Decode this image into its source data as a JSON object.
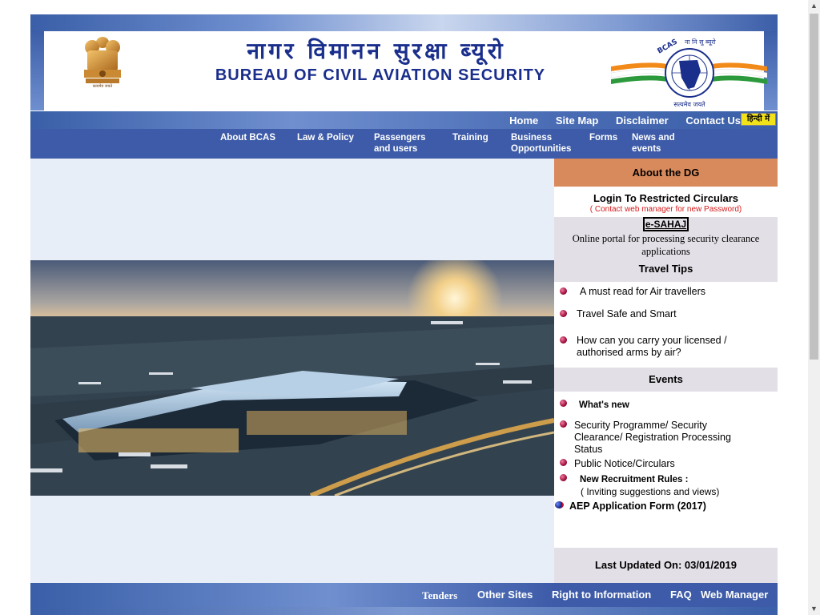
{
  "header": {
    "hindi_title": "नागर विमानन सुरक्षा ब्यूरो",
    "english_title": "BUREAU OF CIVIL AVIATION SECURITY",
    "logo_top_text": "BCAS",
    "logo_hindi_top": "ना नि सु ब्यूरो",
    "logo_motto": "सत्यमेव जयते"
  },
  "util_nav": {
    "links": [
      "Home",
      "Site Map",
      "Disclaimer",
      "Contact Us"
    ],
    "hindi_button": "हिन्दी में"
  },
  "main_nav": [
    "About BCAS",
    "Law & Policy",
    "Passengers and users",
    "Training",
    "Business Opportunities",
    "Forms",
    "News and events"
  ],
  "main_nav_lines": [
    [
      "About BCAS",
      ""
    ],
    [
      "Law & Policy",
      ""
    ],
    [
      "Passengers",
      "and users"
    ],
    [
      "Training",
      ""
    ],
    [
      "Business",
      "Opportunities"
    ],
    [
      "Forms",
      ""
    ],
    [
      "News and",
      "events"
    ]
  ],
  "right_col": {
    "about_dg": "About the DG",
    "login_title": "Login To Restricted Circulars",
    "login_note": "(  Contact web manager for new Password)",
    "esahaj_label": "e-SAHAJ",
    "esahaj_desc": "Online portal for processing security clearance applications",
    "travel_tips_head": "Travel Tips",
    "travel_tips": [
      "A must read for Air travellers",
      "Travel Safe and Smart",
      "How can you carry your   licensed / authorised arms by air?"
    ],
    "events_head": "Events",
    "events": {
      "whats_new": "What's new",
      "security_programme": "Security Programme/ Security Clearance/ Registration Processing Status",
      "public_notice": "Public Notice/Circulars",
      "recruitment_title": "New Recruitment Rules :",
      "recruitment_note": "( Inviting suggestions and views)",
      "aep": "AEP Application  Form (2017)"
    },
    "last_updated": "Last Updated On: 03/01/2019"
  },
  "footer_nav": [
    "Tenders",
    "Other Sites",
    "Right to Information",
    "FAQ",
    "Web Manager"
  ],
  "colors": {
    "nav_blue": "#3d5ba8",
    "title_blue": "#1a2e8c",
    "dg_orange": "#d98a5c",
    "panel_grey": "#e3dfe6",
    "note_red": "#d61a1a",
    "hindi_button_yellow": "#f2e21a"
  }
}
